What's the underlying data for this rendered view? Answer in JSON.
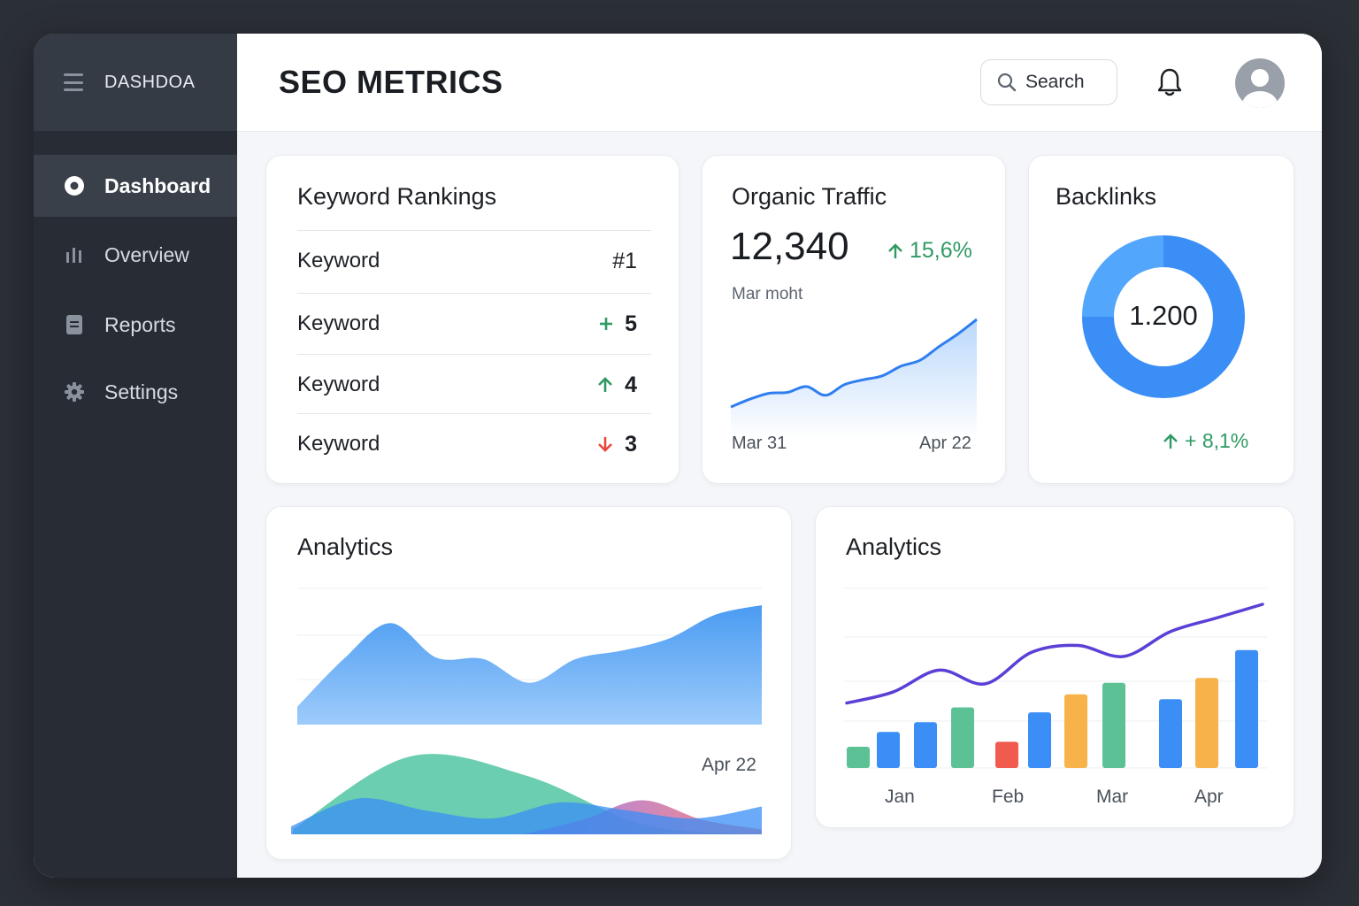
{
  "brand": {
    "name": "DASHDOA"
  },
  "sidebar": {
    "items": [
      {
        "label": "Dashboard",
        "icon": "dashboard-icon",
        "active": true
      },
      {
        "label": "Overview",
        "icon": "bar-chart-icon",
        "active": false
      },
      {
        "label": "Reports",
        "icon": "document-icon",
        "active": false
      },
      {
        "label": "Settings",
        "icon": "gear-icon",
        "active": false
      }
    ]
  },
  "header": {
    "title": "SEO METRICS",
    "search_label": "Search"
  },
  "keyword_rankings": {
    "title": "Keyword Rankings",
    "rows": [
      {
        "keyword": "Keyword",
        "trend": "none",
        "rank": "#1"
      },
      {
        "keyword": "Keyword",
        "trend": "plus",
        "rank": "5"
      },
      {
        "keyword": "Keyword",
        "trend": "up",
        "rank": "4"
      },
      {
        "keyword": "Keyword",
        "trend": "down",
        "rank": "3"
      }
    ]
  },
  "organic_traffic": {
    "title": "Organic Traffic",
    "value": "12,340",
    "delta": "15,6%",
    "subtitle": "Mar moht",
    "x_start": "Mar  31",
    "x_end": "Apr 22"
  },
  "backlinks": {
    "title": "Backlinks",
    "value": "1.200",
    "delta": "+ 8,1%"
  },
  "analytics_left": {
    "title": "Analytics",
    "date_label": "Apr 22"
  },
  "analytics_right": {
    "title": "Analytics",
    "x_labels": [
      "Jan",
      "Feb",
      "Mar",
      "Apr"
    ]
  },
  "colors": {
    "accent_blue": "#3a8ef6",
    "green": "#2f9a63",
    "red": "#e8483b",
    "purple": "#5b3fd6",
    "orange": "#f7b24a",
    "teal": "#5cc295",
    "sidebar": "#282d35"
  },
  "chart_data": [
    {
      "type": "line",
      "title": "Organic Traffic",
      "x_labels": [
        "Mar  31",
        "Apr 22"
      ],
      "series": [
        {
          "values": [
            10,
            18,
            24,
            25,
            31,
            22,
            33,
            38,
            42,
            52,
            58,
            72,
            85,
            100
          ]
        }
      ]
    },
    {
      "type": "pie",
      "title": "Backlinks",
      "center_label": "1.200",
      "values": [
        75,
        25
      ]
    },
    {
      "type": "area",
      "title": "Analytics",
      "series": [
        {
          "values": [
            15,
            55,
            85,
            56,
            55,
            35,
            55,
            62,
            72,
            92,
            100
          ]
        },
        {
          "values": [
            10,
            45,
            30,
            20,
            40,
            30,
            20,
            35
          ]
        },
        {
          "values": [
            5,
            80,
            60,
            10,
            0
          ]
        },
        {
          "values": [
            0,
            15,
            35,
            15,
            5
          ]
        }
      ]
    },
    {
      "type": "bar",
      "title": "Analytics",
      "categories": [
        "Jan",
        "Feb",
        "Mar",
        "Apr"
      ],
      "values": [
        13,
        22,
        28,
        37,
        16,
        34,
        45,
        52,
        42,
        55,
        72
      ],
      "bar_colors": [
        "#5cc295",
        "#3a8ef6",
        "#3a8ef6",
        "#5cc295",
        "#f15b4e",
        "#3a8ef6",
        "#f7b24a",
        "#5cc295",
        "#3a8ef6",
        "#f7b24a",
        "#3a8ef6"
      ],
      "series": [
        {
          "values": [
            28,
            36,
            52,
            42,
            65,
            70,
            62,
            80,
            90,
            100
          ]
        }
      ]
    }
  ]
}
